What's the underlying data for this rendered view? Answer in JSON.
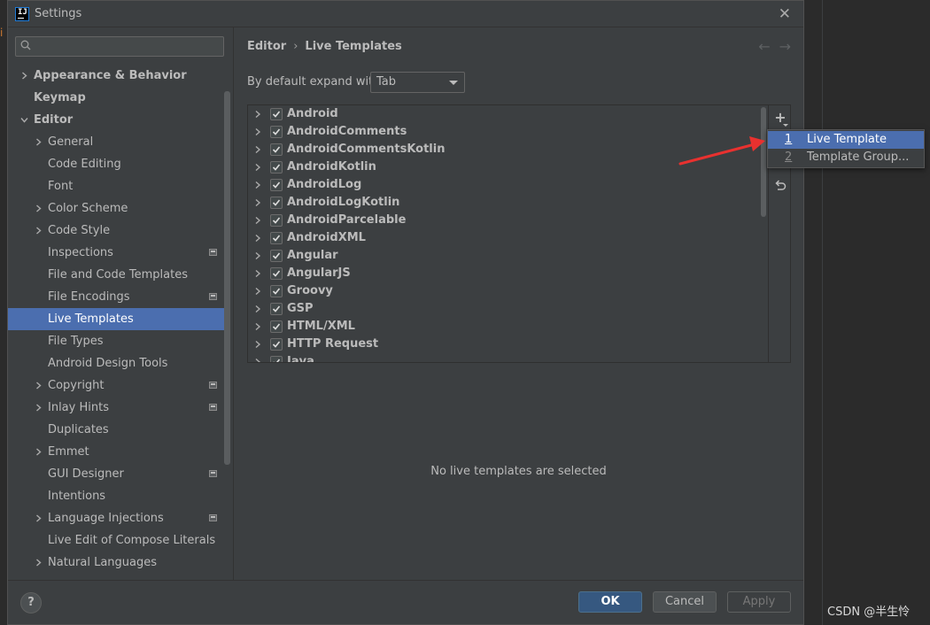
{
  "background": {
    "editor_mark": "i",
    "watermark": "CSDN @半生怜"
  },
  "dialog": {
    "title": "Settings",
    "app_icon": "IJ",
    "close_icon": "close-icon"
  },
  "sidebar": {
    "search": {
      "value": "",
      "placeholder": ""
    },
    "items": [
      {
        "label": "Appearance & Behavior",
        "level": 0,
        "expandable": true,
        "bold": true,
        "project": false,
        "selected": false
      },
      {
        "label": "Keymap",
        "level": 0,
        "expandable": false,
        "bold": true,
        "project": false,
        "selected": false
      },
      {
        "label": "Editor",
        "level": 0,
        "expandable": true,
        "expanded": true,
        "bold": true,
        "project": false,
        "selected": false
      },
      {
        "label": "General",
        "level": 1,
        "expandable": true,
        "bold": false,
        "project": false,
        "selected": false
      },
      {
        "label": "Code Editing",
        "level": 1,
        "expandable": false,
        "bold": false,
        "project": false,
        "selected": false
      },
      {
        "label": "Font",
        "level": 1,
        "expandable": false,
        "bold": false,
        "project": false,
        "selected": false
      },
      {
        "label": "Color Scheme",
        "level": 1,
        "expandable": true,
        "bold": false,
        "project": false,
        "selected": false
      },
      {
        "label": "Code Style",
        "level": 1,
        "expandable": true,
        "bold": false,
        "project": false,
        "selected": false
      },
      {
        "label": "Inspections",
        "level": 1,
        "expandable": false,
        "bold": false,
        "project": true,
        "selected": false
      },
      {
        "label": "File and Code Templates",
        "level": 1,
        "expandable": false,
        "bold": false,
        "project": false,
        "selected": false
      },
      {
        "label": "File Encodings",
        "level": 1,
        "expandable": false,
        "bold": false,
        "project": true,
        "selected": false
      },
      {
        "label": "Live Templates",
        "level": 1,
        "expandable": false,
        "bold": false,
        "project": false,
        "selected": true
      },
      {
        "label": "File Types",
        "level": 1,
        "expandable": false,
        "bold": false,
        "project": false,
        "selected": false
      },
      {
        "label": "Android Design Tools",
        "level": 1,
        "expandable": false,
        "bold": false,
        "project": false,
        "selected": false
      },
      {
        "label": "Copyright",
        "level": 1,
        "expandable": true,
        "bold": false,
        "project": true,
        "selected": false
      },
      {
        "label": "Inlay Hints",
        "level": 1,
        "expandable": true,
        "bold": false,
        "project": true,
        "selected": false
      },
      {
        "label": "Duplicates",
        "level": 1,
        "expandable": false,
        "bold": false,
        "project": false,
        "selected": false
      },
      {
        "label": "Emmet",
        "level": 1,
        "expandable": true,
        "bold": false,
        "project": false,
        "selected": false
      },
      {
        "label": "GUI Designer",
        "level": 1,
        "expandable": false,
        "bold": false,
        "project": true,
        "selected": false
      },
      {
        "label": "Intentions",
        "level": 1,
        "expandable": false,
        "bold": false,
        "project": false,
        "selected": false
      },
      {
        "label": "Language Injections",
        "level": 1,
        "expandable": true,
        "bold": false,
        "project": true,
        "selected": false
      },
      {
        "label": "Live Edit of Compose Literals",
        "level": 1,
        "expandable": false,
        "bold": false,
        "project": false,
        "selected": false
      },
      {
        "label": "Natural Languages",
        "level": 1,
        "expandable": true,
        "bold": false,
        "project": false,
        "selected": false
      }
    ]
  },
  "main": {
    "breadcrumb": {
      "parent": "Editor",
      "separator": "›",
      "current": "Live Templates"
    },
    "nav": {
      "back": "←",
      "forward": "→"
    },
    "expand_with": {
      "label": "By default expand with",
      "value": "Tab"
    },
    "template_groups": [
      {
        "label": "Android",
        "checked": true
      },
      {
        "label": "AndroidComments",
        "checked": true
      },
      {
        "label": "AndroidCommentsKotlin",
        "checked": true
      },
      {
        "label": "AndroidKotlin",
        "checked": true
      },
      {
        "label": "AndroidLog",
        "checked": true
      },
      {
        "label": "AndroidLogKotlin",
        "checked": true
      },
      {
        "label": "AndroidParcelable",
        "checked": true
      },
      {
        "label": "AndroidXML",
        "checked": true
      },
      {
        "label": "Angular",
        "checked": true
      },
      {
        "label": "AngularJS",
        "checked": true
      },
      {
        "label": "Groovy",
        "checked": true
      },
      {
        "label": "GSP",
        "checked": true
      },
      {
        "label": "HTML/XML",
        "checked": true
      },
      {
        "label": "HTTP Request",
        "checked": true
      },
      {
        "label": "Java",
        "checked": true
      }
    ],
    "toolbar": {
      "add": "+",
      "restore": "restore-icon"
    },
    "empty_message": "No live templates are selected"
  },
  "popup": {
    "items": [
      {
        "num": "1",
        "label": "Live Template",
        "highlighted": true
      },
      {
        "num": "2",
        "label": "Template Group...",
        "highlighted": false
      }
    ]
  },
  "footer": {
    "help": "?",
    "ok": "OK",
    "cancel": "Cancel",
    "apply": "Apply"
  },
  "colors": {
    "selection": "#4b6eaf",
    "dialog_bg": "#3c3f41",
    "ok_button": "#365880",
    "annotation_arrow": "#e8312f"
  }
}
